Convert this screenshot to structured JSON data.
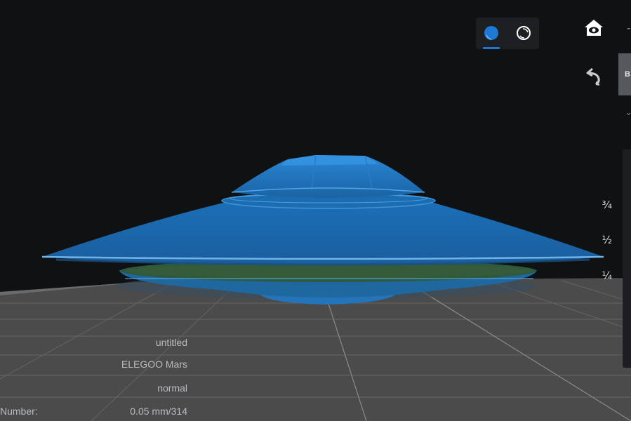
{
  "view_toggle": {
    "solid_icon": "solid-sphere-icon",
    "xray_icon": "xray-sphere-icon",
    "active": "solid",
    "accent": "#1d79d4"
  },
  "toolbar": {
    "home_icon": "home-eye-icon",
    "rotate_icon": "rotate-back-icon"
  },
  "side_tab": {
    "label": "B"
  },
  "layer_slider": {
    "marks": {
      "three_quarter": "³⁄₄",
      "half": "½",
      "quarter": "¼"
    }
  },
  "model_info": {
    "name": "untitled",
    "printer": "ELEGOO Mars",
    "mode": "normal",
    "layer_label": "Number:",
    "layer_value": "0.05 mm/314"
  },
  "colors": {
    "background": "#101113",
    "floor": "#4b4b4c",
    "model": "#1d6bb0"
  }
}
